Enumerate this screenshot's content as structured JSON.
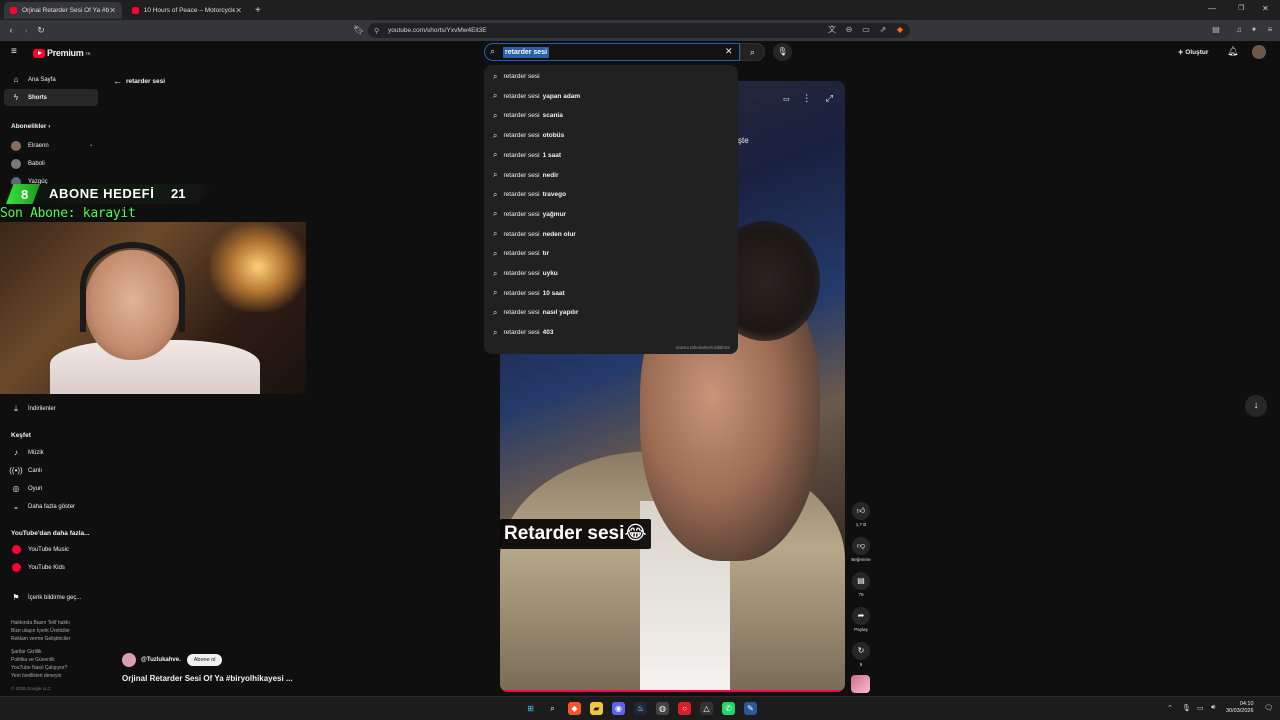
{
  "browser": {
    "tabs": [
      {
        "title": "Orjinal Retarder Sesi Of Ya #biryolhikayesi",
        "active": true
      },
      {
        "title": "10 Hours of Peace – Motorcycle Night",
        "active": false
      }
    ],
    "new_tab": "+",
    "url": "youtube.com/shorts/YxvMw4Eit3E",
    "window_controls": [
      "—",
      "❐",
      "✕"
    ]
  },
  "youtube": {
    "logo_text": "Premium",
    "logo_sup": "TR",
    "search": {
      "value": "retarder sesi"
    },
    "create_label": "Oluştur"
  },
  "sidebar": {
    "home": "Ana Sayfa",
    "shorts": "Shorts",
    "subscriptions_header": "Abonelikler",
    "channels": [
      {
        "name": "Elraenn",
        "color": "#8a6a58"
      },
      {
        "name": "Baboli",
        "color": "#7a7a7a"
      },
      {
        "name": "Yazgüç",
        "color": "#5a6a7a"
      }
    ],
    "downloads": "İndirilenler",
    "explore_header": "Keşfet",
    "explore": [
      "Müzik",
      "Canlı",
      "Oyun",
      "Daha fazla göster"
    ],
    "more_header": "YouTube'dan daha fazla...",
    "more": [
      "YouTube Music",
      "YouTube Kids"
    ],
    "report": "İçerik bildirme geç...",
    "footer": [
      "Hakkında  Basın  Telif hakkı",
      "Bize ulaşın  İçerik Üreticiler",
      "Reklam verme  Geliştiriciler",
      "",
      "Şartlar  Gizlilik",
      "Politika ve Güvenlik",
      "YouTube Nasıl Çalışıyor?",
      "Yeni özellikleri deneyin",
      "",
      "© 2026 Google LLC"
    ]
  },
  "breadcrumb": {
    "back_label": "retarder sesi"
  },
  "suggestions": {
    "base": "retarder sesi",
    "items": [
      "",
      "yapan adam",
      "scania",
      "otobüs",
      "1 saat",
      "nedir",
      "travego",
      "yağmur",
      "neden olur",
      "tır",
      "uyku",
      "10 saat",
      "nasıl yapılır",
      "403"
    ],
    "footer": "Arama tahminlerini bildirme"
  },
  "video": {
    "caption": "Retarder sesi😂",
    "overlay_text": "şte",
    "channel": "@Tuzlukahve.",
    "subscribe": "Abone ol",
    "title": "Orjinal Retarder Sesi Of Ya #biryolhikayesi ..."
  },
  "actions": {
    "like_count": "1,7 B",
    "dislike_label": "Beğenme",
    "comments": "79",
    "share": "Paylaş",
    "remix": "9"
  },
  "stream_overlay": {
    "current": "8",
    "goal_label": "ABONE HEDEFİ",
    "target": "21",
    "last_sub": "Son Abone: karayit"
  },
  "taskbar": {
    "time": "04:10",
    "date": "30/03/2026"
  }
}
